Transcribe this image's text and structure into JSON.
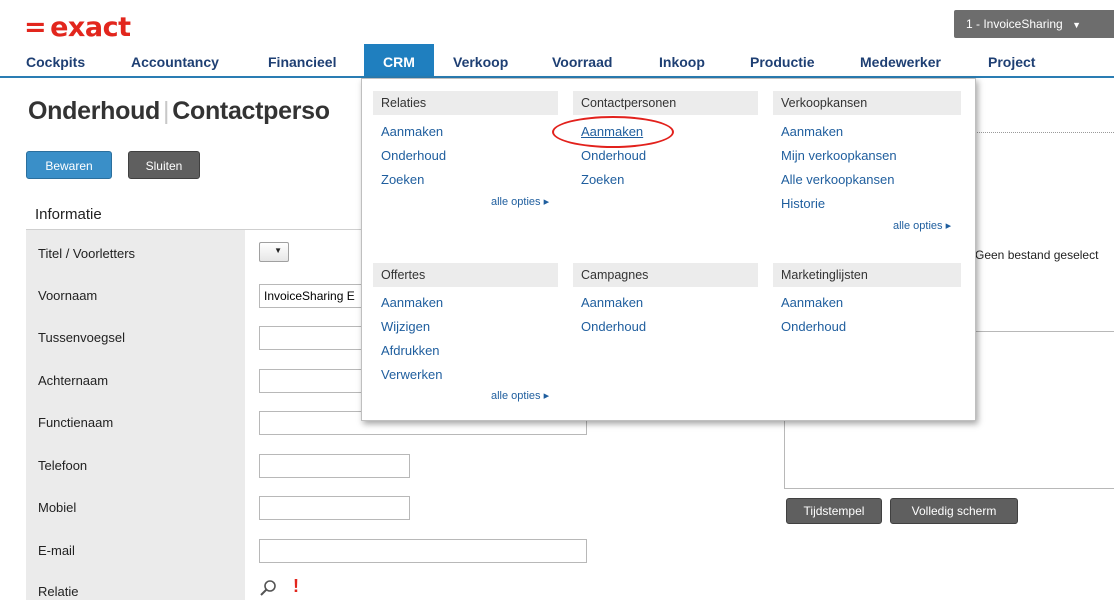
{
  "header": {
    "logo_eq": "=",
    "logo_text": "exact",
    "company": "1 - InvoiceSharing",
    "company_chevron": "▼"
  },
  "nav": {
    "items": [
      {
        "label": "Cockpits"
      },
      {
        "label": "Accountancy"
      },
      {
        "label": "Financieel"
      },
      {
        "label": "CRM",
        "active": true
      },
      {
        "label": "Verkoop"
      },
      {
        "label": "Voorraad"
      },
      {
        "label": "Inkoop"
      },
      {
        "label": "Productie"
      },
      {
        "label": "Medewerker"
      },
      {
        "label": "Project"
      }
    ]
  },
  "page": {
    "title_part1": "Onderhoud",
    "title_sep": "|",
    "title_part2": "Contactperso"
  },
  "toolbar": {
    "save_label": "Bewaren",
    "close_label": "Sluiten"
  },
  "form": {
    "section_title": "Informatie",
    "fields": [
      {
        "label": "Titel / Voorletters"
      },
      {
        "label": "Voornaam",
        "value": "InvoiceSharing E"
      },
      {
        "label": "Tussenvoegsel",
        "value": ""
      },
      {
        "label": "Achternaam",
        "value": ""
      },
      {
        "label": "Functienaam",
        "value": ""
      },
      {
        "label": "Telefoon",
        "value": ""
      },
      {
        "label": "Mobiel",
        "value": ""
      },
      {
        "label": "E-mail",
        "value": ""
      },
      {
        "label": "Relatie"
      }
    ],
    "required_mark": "!"
  },
  "right": {
    "file_status": "Geen bestand geselect",
    "timestamp_label": "Tijdstempel",
    "fullscreen_label": "Volledig scherm"
  },
  "menu": {
    "more_label": "alle opties ▸",
    "sections": [
      {
        "title": "Relaties",
        "links": [
          "Aanmaken",
          "Onderhoud",
          "Zoeken"
        ]
      },
      {
        "title": "Contactpersonen",
        "links": [
          "Aanmaken",
          "Onderhoud",
          "Zoeken"
        ]
      },
      {
        "title": "Verkoopkansen",
        "links": [
          "Aanmaken",
          "Mijn verkoopkansen",
          "Alle verkoopkansen",
          "Historie"
        ]
      },
      {
        "title": "Offertes",
        "links": [
          "Aanmaken",
          "Wijzigen",
          "Afdrukken",
          "Verwerken"
        ]
      },
      {
        "title": "Campagnes",
        "links": [
          "Aanmaken",
          "Onderhoud"
        ]
      },
      {
        "title": "Marketinglijsten",
        "links": [
          "Aanmaken",
          "Onderhoud"
        ]
      }
    ]
  },
  "colors": {
    "brand_red": "#e2261d",
    "nav_active": "#1f7fbf",
    "nav_text": "#1e3f73",
    "link": "#1f5e9e",
    "highlight_circle": "#e2211c"
  },
  "icons": {
    "relation_search": "search-icon",
    "company_dropdown": "chevron-down-icon"
  }
}
